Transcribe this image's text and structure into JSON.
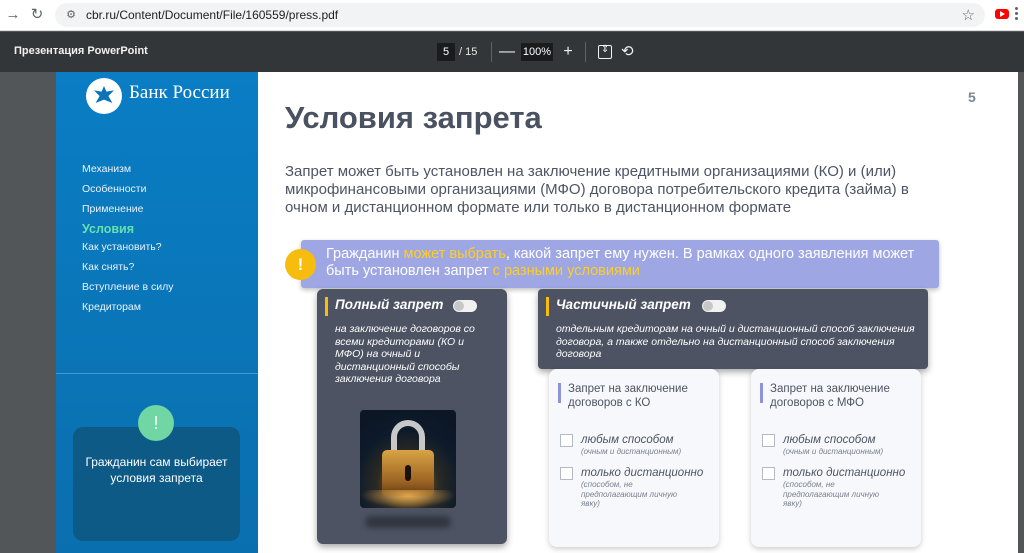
{
  "browser": {
    "url": "cbr.ru/Content/Document/File/160559/press.pdf",
    "back_icon": "arrow-left-icon",
    "reload_icon": "reload-icon"
  },
  "pdf": {
    "title": "Презентация PowerPoint",
    "page_current": "5",
    "page_total": "/ 15",
    "zoom": "100%",
    "zoom_out": "—",
    "zoom_in": "+"
  },
  "slide": {
    "number": "5",
    "logo_text": "Банк России",
    "menu": [
      {
        "label": "Механизм"
      },
      {
        "label": "Особенности"
      },
      {
        "label": "Применение"
      },
      {
        "label": "Условия"
      },
      {
        "label": "Как установить?"
      },
      {
        "label": "Как снять?"
      },
      {
        "label": "Вступление в силу"
      },
      {
        "label": "Кредиторам"
      }
    ],
    "side_card_text": "Гражданин сам выбирает условия запрета",
    "title": "Условия запрета",
    "description": "Запрет может быть установлен на заключение кредитными организациями (КО) и (или) микрофинансовыми организациями (МФО) договора потребительского кредита (займа) в очном и дистанционном формате или только в дистанционном формате",
    "banner": {
      "part1": "Гражданин ",
      "highlight1": "может выбрать",
      "part2": ", какой запрет ему нужен. В рамках одного заявления может быть установлен запрет ",
      "highlight2": "с разными условиями"
    },
    "full_ban": {
      "title": "Полный запрет",
      "desc": "на заключение договоров со всеми кредиторами (КО и МФО) на очный и дистанционный способы заключения договора"
    },
    "partial_ban": {
      "title": "Частичный запрет",
      "desc": "отдельным кредиторам на очный и дистанционный способ заключения договора, а также отдельно на дистанционный способ заключения договора"
    },
    "sub_cards": [
      {
        "title": "Запрет на заключение договоров с КО",
        "opt1": "любым способом",
        "opt1_note": "(очным и дистанционным)",
        "opt2": "только дистанционно",
        "opt2_note": "(способом, не предполагающим личную явку)"
      },
      {
        "title": "Запрет на заключение договоров с МФО",
        "opt1": "любым способом",
        "opt1_note": "(очным и дистанционным)",
        "opt2": "только дистанционно",
        "opt2_note": "(способом, не предполагающим личную явку)"
      }
    ]
  }
}
